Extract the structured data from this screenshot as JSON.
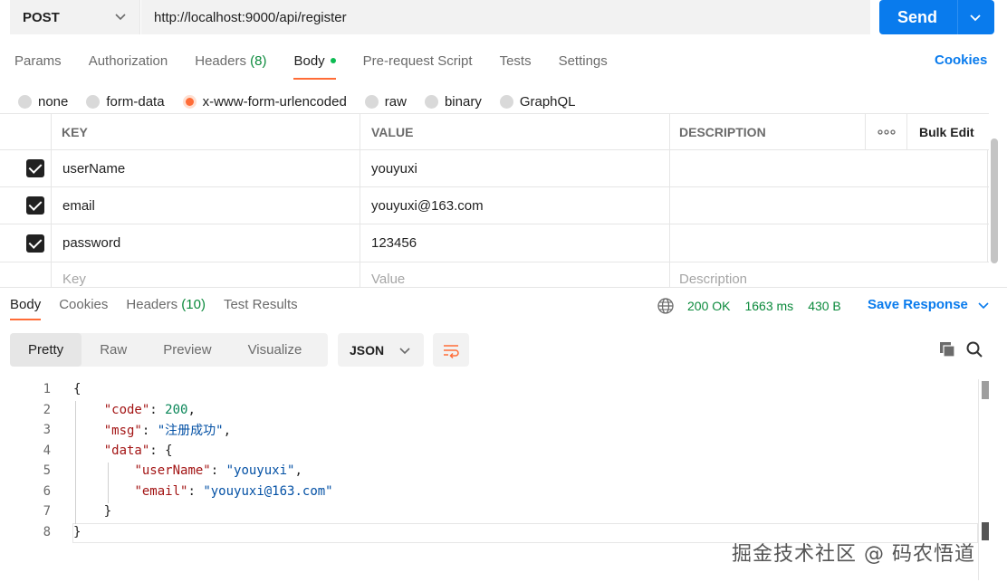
{
  "request": {
    "method": "POST",
    "url": "http://localhost:9000/api/register",
    "send_label": "Send"
  },
  "req_tabs": [
    {
      "label": "Params",
      "count": ""
    },
    {
      "label": "Authorization",
      "count": ""
    },
    {
      "label": "Headers",
      "count": "(8)"
    },
    {
      "label": "Body",
      "count": ""
    },
    {
      "label": "Pre-request Script",
      "count": ""
    },
    {
      "label": "Tests",
      "count": ""
    },
    {
      "label": "Settings",
      "count": ""
    }
  ],
  "cookies_label": "Cookies",
  "body_types": [
    "none",
    "form-data",
    "x-www-form-urlencoded",
    "raw",
    "binary",
    "GraphQL"
  ],
  "table": {
    "headers": {
      "key": "KEY",
      "value": "VALUE",
      "description": "DESCRIPTION",
      "bulk_edit": "Bulk Edit"
    },
    "rows": [
      {
        "key": "userName",
        "value": "youyuxi",
        "description": ""
      },
      {
        "key": "email",
        "value": "youyuxi@163.com",
        "description": ""
      },
      {
        "key": "password",
        "value": "123456",
        "description": ""
      }
    ],
    "placeholders": {
      "key": "Key",
      "value": "Value",
      "description": "Description"
    }
  },
  "response": {
    "tabs": [
      {
        "label": "Body",
        "count": ""
      },
      {
        "label": "Cookies",
        "count": ""
      },
      {
        "label": "Headers",
        "count": "(10)"
      },
      {
        "label": "Test Results",
        "count": ""
      }
    ],
    "status": "200 OK",
    "time": "1663 ms",
    "size": "430 B",
    "save_label": "Save Response",
    "view_tabs": [
      "Pretty",
      "Raw",
      "Preview",
      "Visualize"
    ],
    "format": "JSON"
  },
  "code_lines": [
    {
      "num": "1",
      "text": "{"
    },
    {
      "num": "2",
      "text": "    \"code\": 200,"
    },
    {
      "num": "3",
      "text": "    \"msg\": \"注册成功\","
    },
    {
      "num": "4",
      "text": "    \"data\": {"
    },
    {
      "num": "5",
      "text": "        \"userName\": \"youyuxi\","
    },
    {
      "num": "6",
      "text": "        \"email\": \"youyuxi@163.com\""
    },
    {
      "num": "7",
      "text": "    }"
    },
    {
      "num": "8",
      "text": "}"
    }
  ],
  "watermark": "掘金技术社区 @ 码农悟道",
  "colors": {
    "accent": "#ff6c37",
    "primary": "#097bed",
    "success": "#0b8a3c"
  },
  "icons": [
    "chevron-down-icon",
    "globe-icon",
    "wrap-lines-icon",
    "copy-icon",
    "search-icon",
    "more-icon"
  ]
}
